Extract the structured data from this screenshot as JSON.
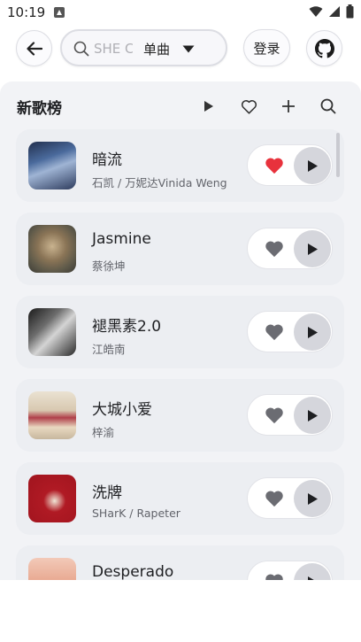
{
  "status_bar": {
    "time": "10:19"
  },
  "header": {
    "search_placeholder": "SHE C",
    "search_type": "单曲",
    "login_label": "登录"
  },
  "panel": {
    "title": "新歌榜"
  },
  "songs": [
    {
      "title": "暗流",
      "artist": "石凯 / 万妮达Vinida Weng",
      "liked": true
    },
    {
      "title": "Jasmine",
      "artist": "蔡徐坤",
      "liked": false
    },
    {
      "title": "褪黑素2.0",
      "artist": "江皓南",
      "liked": false
    },
    {
      "title": "大城小爱",
      "artist": "梓渝",
      "liked": false
    },
    {
      "title": "洗牌",
      "artist": "SHarK / Rapeter",
      "liked": false
    },
    {
      "title": "Desperado",
      "artist": "",
      "liked": false
    }
  ],
  "colors": {
    "liked": "#e8323c",
    "unliked": "#6b6c72",
    "accent_play": "#1e1f22"
  },
  "icons": [
    "back-arrow-icon",
    "search-icon",
    "dropdown-icon",
    "github-icon",
    "play-icon",
    "heart-icon",
    "plus-icon"
  ]
}
